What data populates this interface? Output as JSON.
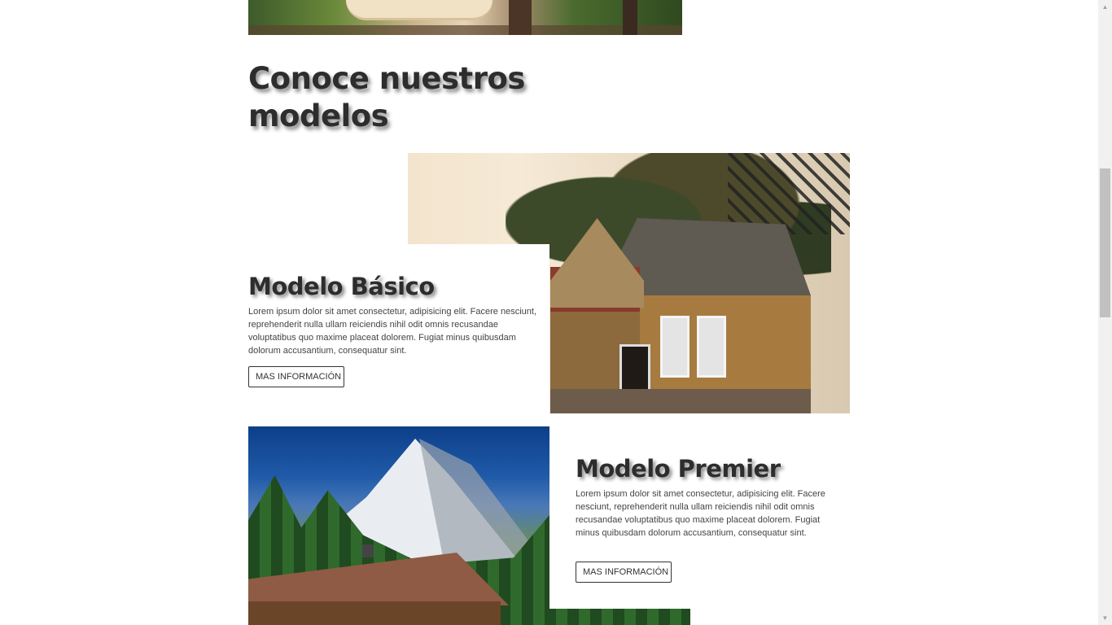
{
  "section": {
    "title": "Conoce nuestros modelos"
  },
  "models": [
    {
      "title": "Modelo Básico",
      "description": "Lorem ipsum dolor sit amet consectetur, adipisicing elit. Facere nesciunt, reprehenderit nulla ullam reiciendis nihil odit omnis recusandae voluptatibus quo maxime placeat dolorem. Fugiat minus quibusdam dolorum accusantium, consequatur sint.",
      "button_label": "MAS INFORMACIÓN"
    },
    {
      "title": "Modelo Premier",
      "description": "Lorem ipsum dolor sit amet consectetur, adipisicing elit. Facere nesciunt, reprehenderit nulla ullam reiciendis nihil odit omnis recusandae voluptatibus quo maxime placeat dolorem. Fugiat minus quibusdam dolorum accusantium, consequatur sint.",
      "button_label": "MAS INFORMACIÓN"
    }
  ],
  "scrollbar": {
    "up_icon": "▲",
    "down_icon": "▼"
  },
  "colors": {
    "heading": "#2d2d2d",
    "background": "#ffffff",
    "scroll_thumb": "#c1c1c1"
  }
}
